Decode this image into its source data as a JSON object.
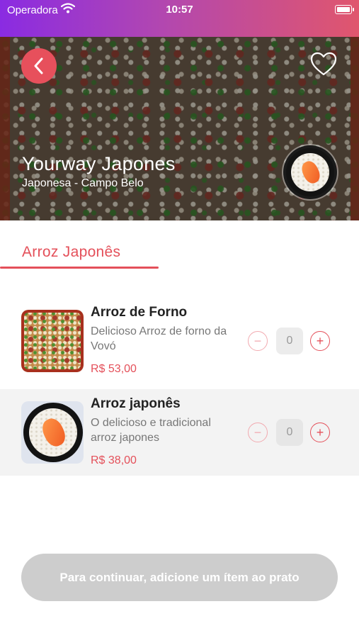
{
  "status_bar": {
    "carrier": "Operadora",
    "time": "10:57"
  },
  "header": {
    "restaurant_name": "Yourway Japones",
    "restaurant_subtitle": "Japonesa - Campo Belo"
  },
  "tab": {
    "label": "Arroz Japonês"
  },
  "items": [
    {
      "title": "Arroz de Forno",
      "description": "Delicioso Arroz de forno da Vovó",
      "price": "R$ 53,00",
      "quantity": "0",
      "minus": "−",
      "plus": "+"
    },
    {
      "title": "Arroz japonês",
      "description": "O delicioso e tradicional arroz japones",
      "price": "R$ 38,00",
      "quantity": "0",
      "minus": "−",
      "plus": "+"
    }
  ],
  "footer": {
    "continue_label": "Para continuar, adicione um ítem ao prato"
  },
  "icons": {
    "back": "chevron-left-icon",
    "favorite": "heart-outline-icon",
    "wifi": "wifi-icon",
    "battery": "battery-icon"
  },
  "colors": {
    "accent": "#e4505a",
    "status_gradient_start": "#8a2be2",
    "status_gradient_end": "#e0566d"
  }
}
